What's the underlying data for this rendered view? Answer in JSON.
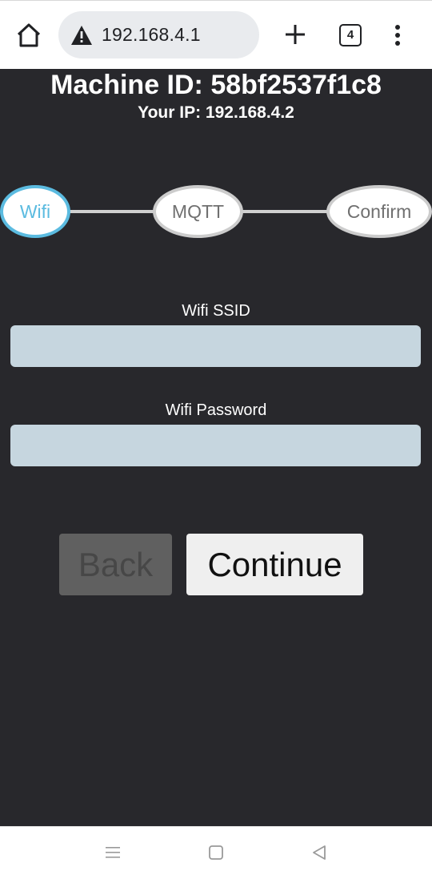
{
  "browser": {
    "url": "192.168.4.1",
    "tab_count": "4",
    "icons": {
      "home": "home-icon",
      "warning": "warning-triangle-icon",
      "new_tab": "plus-icon",
      "menu": "kebab-menu-icon"
    }
  },
  "header": {
    "machine_id": "Machine ID: 58bf2537f1c8",
    "your_ip": "Your IP: 192.168.4.2"
  },
  "steps": [
    {
      "label": "Wifi",
      "active": true
    },
    {
      "label": "MQTT",
      "active": false
    },
    {
      "label": "Confirm",
      "active": false
    }
  ],
  "form": {
    "ssid_label": "Wifi SSID",
    "ssid_value": "",
    "password_label": "Wifi Password",
    "password_value": ""
  },
  "buttons": {
    "back": "Back",
    "continue": "Continue"
  },
  "colors": {
    "page_bg": "#28282c",
    "accent": "#5bbbe0",
    "input_bg": "#c6d6df"
  }
}
